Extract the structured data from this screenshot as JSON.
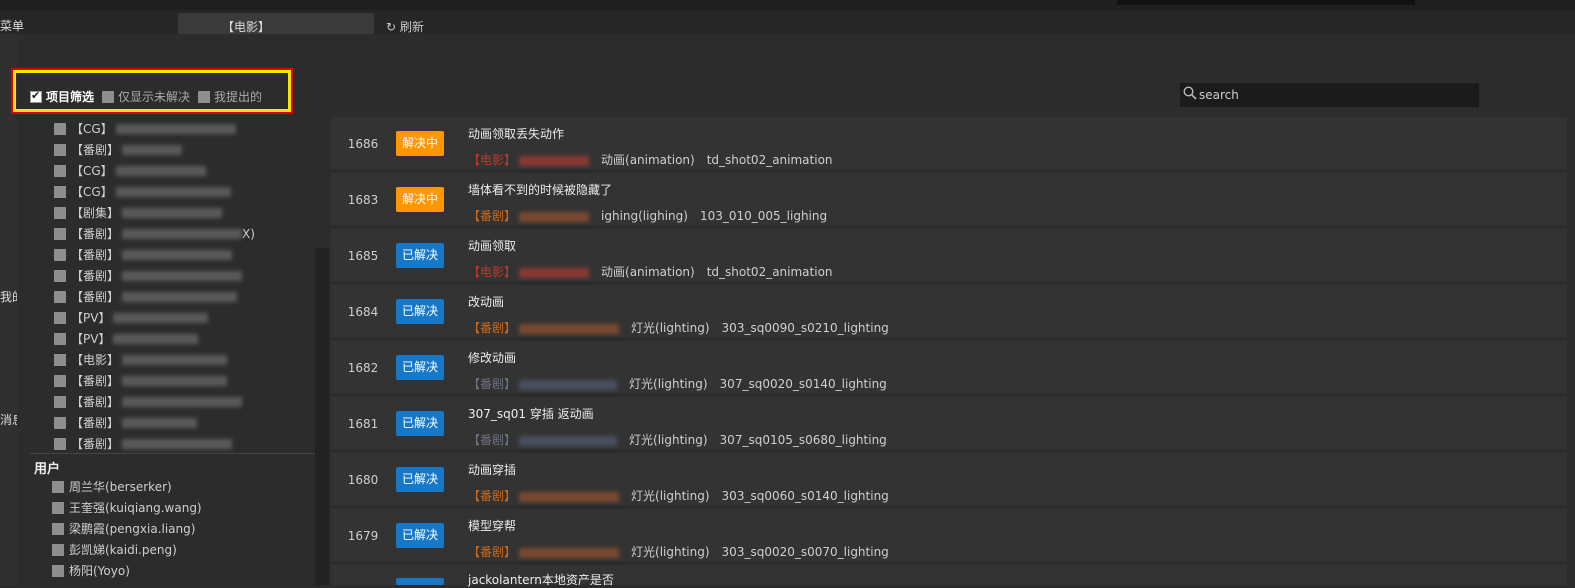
{
  "background": {
    "menu_label": "菜单",
    "tab_label": "【电影】",
    "refresh_label": "刷新",
    "left_fragments": [
      "我的",
      "消息"
    ]
  },
  "filters": {
    "items": [
      {
        "label": "项目筛选",
        "checked": true
      },
      {
        "label": "仅显示未解决",
        "checked": false
      },
      {
        "label": "我提出的",
        "checked": false
      }
    ]
  },
  "search": {
    "placeholder": "search"
  },
  "projects": [
    {
      "tag": "【CG】",
      "blur_w": 120
    },
    {
      "tag": "【番剧】",
      "blur_w": 60
    },
    {
      "tag": "【CG】",
      "blur_w": 90
    },
    {
      "tag": "【CG】",
      "blur_w": 115
    },
    {
      "tag": "【剧集】",
      "blur_w": 100
    },
    {
      "tag": "【番剧】",
      "blur_w": 130,
      "suffix": "X)"
    },
    {
      "tag": "【番剧】",
      "blur_w": 110
    },
    {
      "tag": "【番剧】",
      "blur_w": 120
    },
    {
      "tag": "【番剧】",
      "blur_w": 115
    },
    {
      "tag": "【PV】",
      "blur_w": 95
    },
    {
      "tag": "【PV】",
      "blur_w": 85
    },
    {
      "tag": "【电影】",
      "blur_w": 105
    },
    {
      "tag": "【番剧】",
      "blur_w": 105
    },
    {
      "tag": "【番剧】",
      "blur_w": 120
    },
    {
      "tag": "【番剧】",
      "blur_w": 75
    },
    {
      "tag": "【番剧】",
      "blur_w": 110
    }
  ],
  "users": {
    "heading": "用户",
    "items": [
      "周兰华(berserker)",
      "王奎强(kuiqiang.wang)",
      "梁鹏霞(pengxia.liang)",
      "彭凯娣(kaidi.peng)",
      "杨阳(Yoyo)"
    ]
  },
  "status_colors": {
    "in_progress": "#ff9800",
    "resolved": "#1778c8"
  },
  "issues": [
    {
      "id": "1686",
      "status": "解决中",
      "state": "progress",
      "title": "动画领取丢失动作",
      "project": "【电影】",
      "project_color": "red",
      "task": "动画(animation)",
      "shot": "td_shot02_animation"
    },
    {
      "id": "1683",
      "status": "解决中",
      "state": "progress",
      "title": "墙体看不到的时候被隐藏了",
      "project": "【番剧】",
      "project_color": "orange",
      "task": "ighing(lighing)",
      "shot": "103_010_005_lighing"
    },
    {
      "id": "1685",
      "status": "已解决",
      "state": "resolved",
      "title": "动画领取",
      "project": "【电影】",
      "project_color": "red",
      "task": "动画(animation)",
      "shot": "td_shot02_animation"
    },
    {
      "id": "1684",
      "status": "已解决",
      "state": "resolved",
      "title": "改动画",
      "project": "【番剧】",
      "project_color": "orange",
      "task": "灯光(lighting)",
      "shot": "303_sq0090_s0210_lighting"
    },
    {
      "id": "1682",
      "status": "已解决",
      "state": "resolved",
      "title": "修改动画",
      "project": "【番剧】",
      "project_color": "grey",
      "task": "灯光(lighting)",
      "shot": "307_sq0020_s0140_lighting"
    },
    {
      "id": "1681",
      "status": "已解决",
      "state": "resolved",
      "title": "307_sq01 穿插 返动画",
      "project": "【番剧】",
      "project_color": "grey",
      "task": "灯光(lighting)",
      "shot": "307_sq0105_s0680_lighting"
    },
    {
      "id": "1680",
      "status": "已解决",
      "state": "resolved",
      "title": "动画穿插",
      "project": "【番剧】",
      "project_color": "orange",
      "task": "灯光(lighting)",
      "shot": "303_sq0060_s0140_lighting"
    },
    {
      "id": "1679",
      "status": "已解决",
      "state": "resolved",
      "title": "模型穿帮",
      "project": "【番剧】",
      "project_color": "orange",
      "task": "灯光(lighting)",
      "shot": "303_sq0020_s0070_lighting"
    },
    {
      "id": "",
      "status": "",
      "state": "resolved",
      "title": "jackolantern本地资产是否",
      "project": "",
      "project_color": "orange",
      "task": "",
      "shot": ""
    }
  ]
}
